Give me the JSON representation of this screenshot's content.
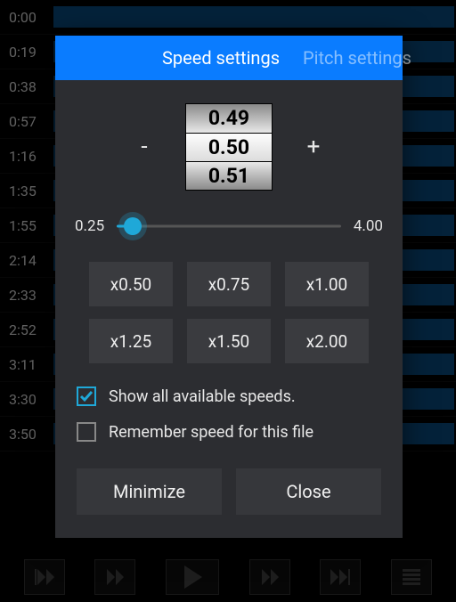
{
  "background": {
    "timestamps": [
      "0:00",
      "0:19",
      "0:38",
      "0:57",
      "1:16",
      "1:35",
      "1:55",
      "2:14",
      "2:33",
      "2:52",
      "3:11",
      "3:30",
      "3:50"
    ]
  },
  "tabs": {
    "active": "Speed settings",
    "inactive": "Pitch settings"
  },
  "wheel": {
    "prev": "0.49",
    "current": "0.50",
    "next": "0.51"
  },
  "stepper": {
    "minus": "-",
    "plus": "+"
  },
  "slider": {
    "min": "0.25",
    "max": "4.00",
    "value": 0.5,
    "fill_percent": 7
  },
  "presets": [
    "x0.50",
    "x0.75",
    "x1.00",
    "x1.25",
    "x1.50",
    "x2.00"
  ],
  "checks": {
    "show_all": {
      "label": "Show all available speeds.",
      "checked": true
    },
    "remember": {
      "label": "Remember speed for this file",
      "checked": false
    }
  },
  "buttons": {
    "minimize": "Minimize",
    "close": "Close"
  }
}
